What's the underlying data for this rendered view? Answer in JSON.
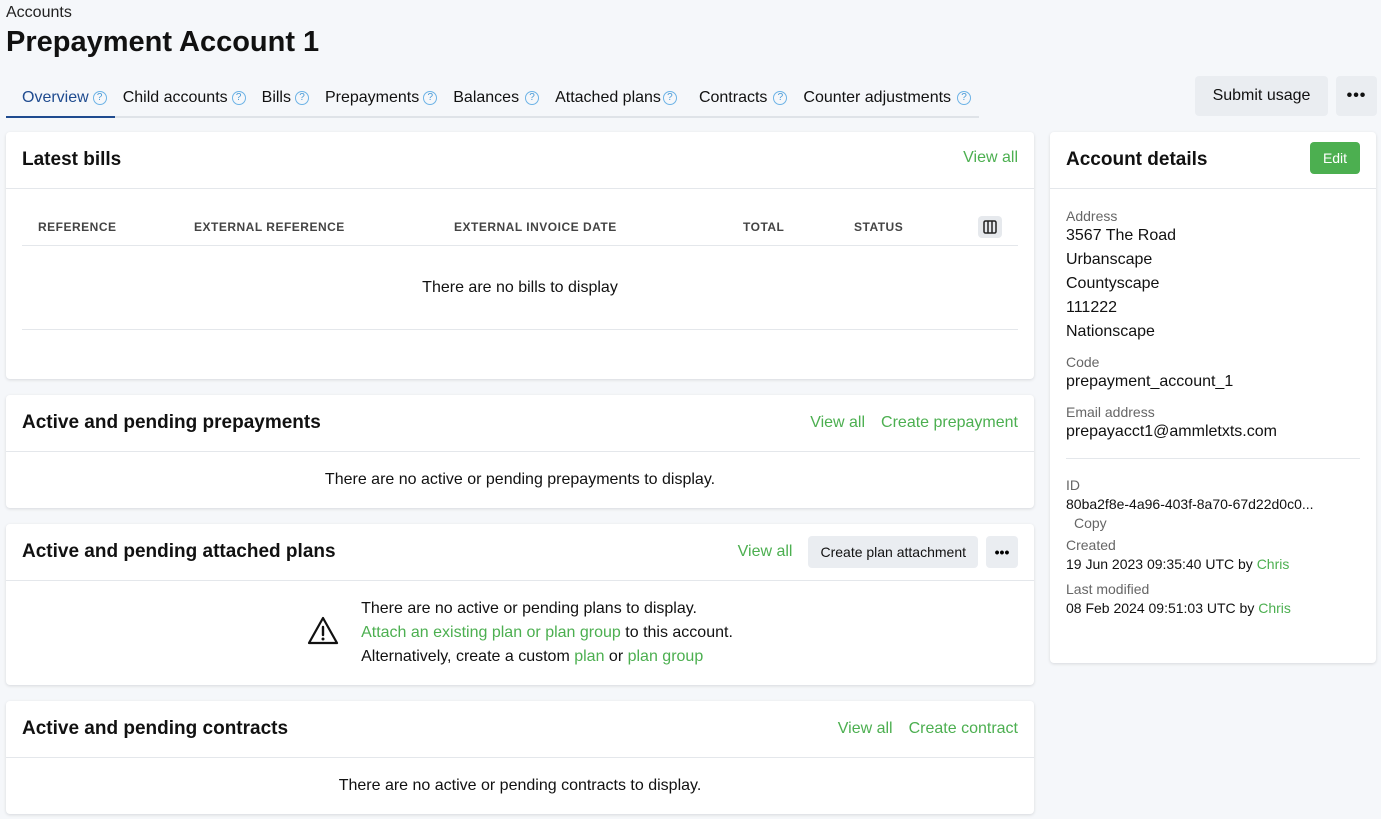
{
  "breadcrumb": "Accounts",
  "page_title": "Prepayment Account 1",
  "tabs": [
    {
      "label": "Overview"
    },
    {
      "label": "Child accounts"
    },
    {
      "label": "Bills"
    },
    {
      "label": "Prepayments"
    },
    {
      "label": "Balances"
    },
    {
      "label": "Attached plans"
    },
    {
      "label": "Contracts"
    },
    {
      "label": "Counter adjustments"
    }
  ],
  "help_glyph": "?",
  "header_actions": {
    "submit_usage": "Submit usage",
    "more": "•••"
  },
  "latest_bills": {
    "title": "Latest bills",
    "view_all": "View all",
    "columns": [
      "REFERENCE",
      "EXTERNAL REFERENCE",
      "EXTERNAL INVOICE DATE",
      "TOTAL",
      "STATUS"
    ],
    "empty": "There are no bills to display"
  },
  "prepayments": {
    "title": "Active and pending prepayments",
    "view_all": "View all",
    "create": "Create prepayment",
    "empty": "There are no active or pending prepayments to display."
  },
  "plans": {
    "title": "Active and pending attached plans",
    "view_all": "View all",
    "create": "Create plan attachment",
    "more": "•••",
    "line1": "There are no active or pending plans to display.",
    "attach_link": "Attach an existing plan or plan group",
    "line2_rest": " to this account.",
    "line3_prefix": "Alternatively, create a custom ",
    "plan_link": "plan",
    "or": " or ",
    "plan_group_link": "plan group"
  },
  "contracts": {
    "title": "Active and pending contracts",
    "view_all": "View all",
    "create": "Create contract",
    "empty": "There are no active or pending contracts to display."
  },
  "account_details": {
    "title": "Account details",
    "edit": "Edit",
    "address_label": "Address",
    "address_lines": [
      "3567 The Road",
      "Urbanscape",
      "Countyscape",
      "111222",
      "Nationscape"
    ],
    "code_label": "Code",
    "code": "prepayment_account_1",
    "email_label": "Email address",
    "email": "prepayacct1@ammletxts.com",
    "id_label": "ID",
    "id": "80ba2f8e-4a96-403f-8a70-67d22d0c0...",
    "copy": "Copy",
    "created_label": "Created",
    "created": "19 Jun 2023 09:35:40 UTC by ",
    "created_by": "Chris",
    "modified_label": "Last modified",
    "modified": "08 Feb 2024 09:51:03 UTC by ",
    "modified_by": "Chris"
  },
  "colors": {
    "accent_green": "#4caf50",
    "active_tab": "#1f4b8f"
  }
}
